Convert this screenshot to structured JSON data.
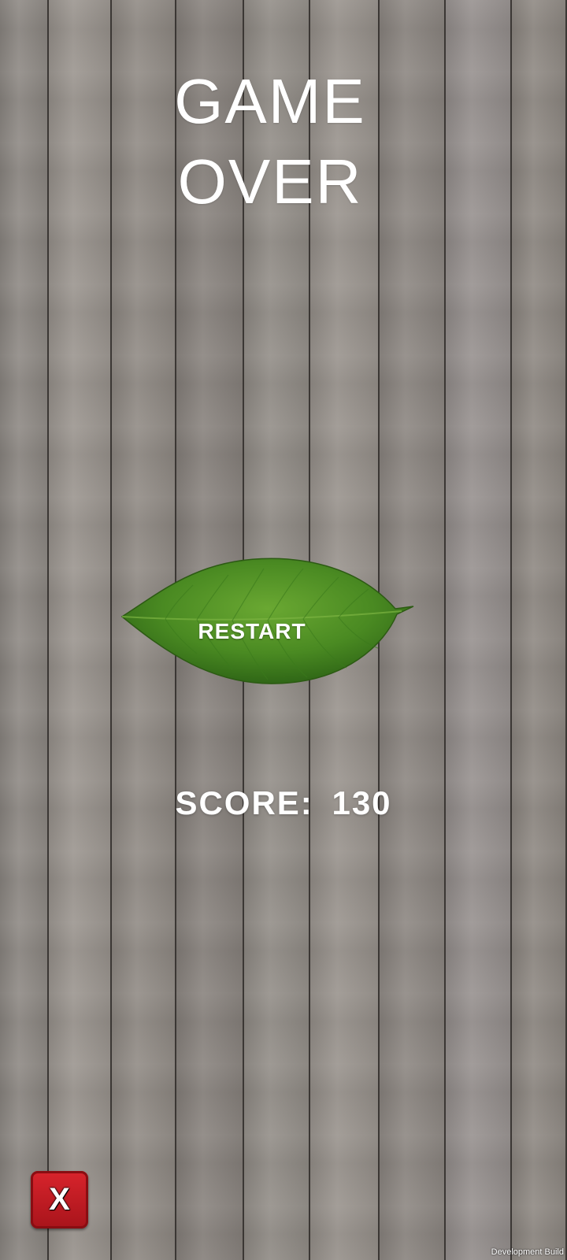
{
  "title_lines": [
    "GAME",
    "OVER"
  ],
  "restart_label": "RESTART",
  "score": {
    "label": "SCORE:",
    "value": "130"
  },
  "close_button": {
    "icon": "close-icon",
    "glyph": "X"
  },
  "footer": {
    "dev_build": "Development Build"
  },
  "colors": {
    "wood_dark": "#3b3734",
    "leaf_green": "#4f8f23",
    "close_red": "#c81d25",
    "text": "#ffffff"
  }
}
